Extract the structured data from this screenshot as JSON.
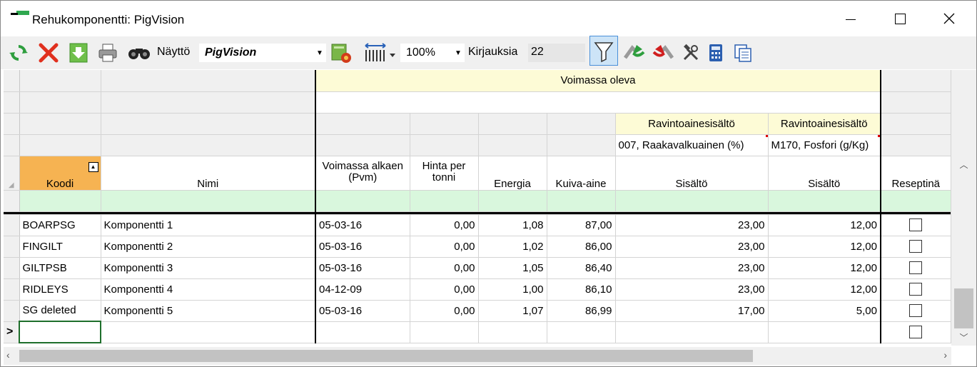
{
  "window": {
    "title": "Rehukomponentti: PigVision",
    "minimize_icon": "minimize-icon",
    "maximize_icon": "maximize-icon",
    "close_icon": "close-icon"
  },
  "toolbar": {
    "nayto_label": "Näyttö",
    "view_value": "PigVision",
    "zoom_value": "100%",
    "kirjauksia_label": "Kirjauksia",
    "kirjauksia_value": "22",
    "icons": [
      "refresh-icon",
      "delete-icon",
      "download-icon",
      "print-icon",
      "find-icon",
      "settings-icon",
      "column-width-icon",
      "filter-icon",
      "forward-icon",
      "back-icon",
      "tools-icon",
      "calculator-icon",
      "copy-icon"
    ]
  },
  "grid": {
    "group_header": "Voimassa oleva",
    "nutrient_group_1": "Ravintoainesisältö",
    "nutrient_group_2": "Ravintoainesisältö",
    "nutrient_1": "007, Raakavalkuainen (%)",
    "nutrient_2": "M170, Fosfori (g/Kg)",
    "columns": {
      "koodi": "Koodi",
      "nimi": "Nimi",
      "voimassa_alkaen": "Voimassa alkaen (Pvm)",
      "hinta": "Hinta per tonni",
      "energia": "Energia",
      "kuiva_aine": "Kuiva-aine",
      "sisalto1": "Sisältö",
      "sisalto2": "Sisältö",
      "reseptina": "Reseptinä"
    },
    "rows": [
      {
        "koodi": "BOARPSG",
        "nimi": "Komponentti 1",
        "pvm": "05-03-16",
        "hinta": "0,00",
        "energia": "1,08",
        "kuiva": "87,00",
        "s1": "23,00",
        "s2": "12,00"
      },
      {
        "koodi": "FINGILT",
        "nimi": "Komponentti 2",
        "pvm": "05-03-16",
        "hinta": "0,00",
        "energia": "1,02",
        "kuiva": "86,00",
        "s1": "23,00",
        "s2": "12,00"
      },
      {
        "koodi": "GILTPSB",
        "nimi": "Komponentti 3",
        "pvm": "05-03-16",
        "hinta": "0,00",
        "energia": "1,05",
        "kuiva": "86,40",
        "s1": "23,00",
        "s2": "12,00"
      },
      {
        "koodi": "RIDLEYS",
        "nimi": "Komponentti 4",
        "pvm": "04-12-09",
        "hinta": "0,00",
        "energia": "1,00",
        "kuiva": "86,10",
        "s1": "23,00",
        "s2": "12,00"
      },
      {
        "koodi": "SG  deleted",
        "nimi": "Komponentti 5",
        "pvm": "05-03-16",
        "hinta": "0,00",
        "energia": "1,07",
        "kuiva": "86,99",
        "s1": "17,00",
        "s2": "5,00"
      }
    ],
    "new_row_marker": ">"
  }
}
